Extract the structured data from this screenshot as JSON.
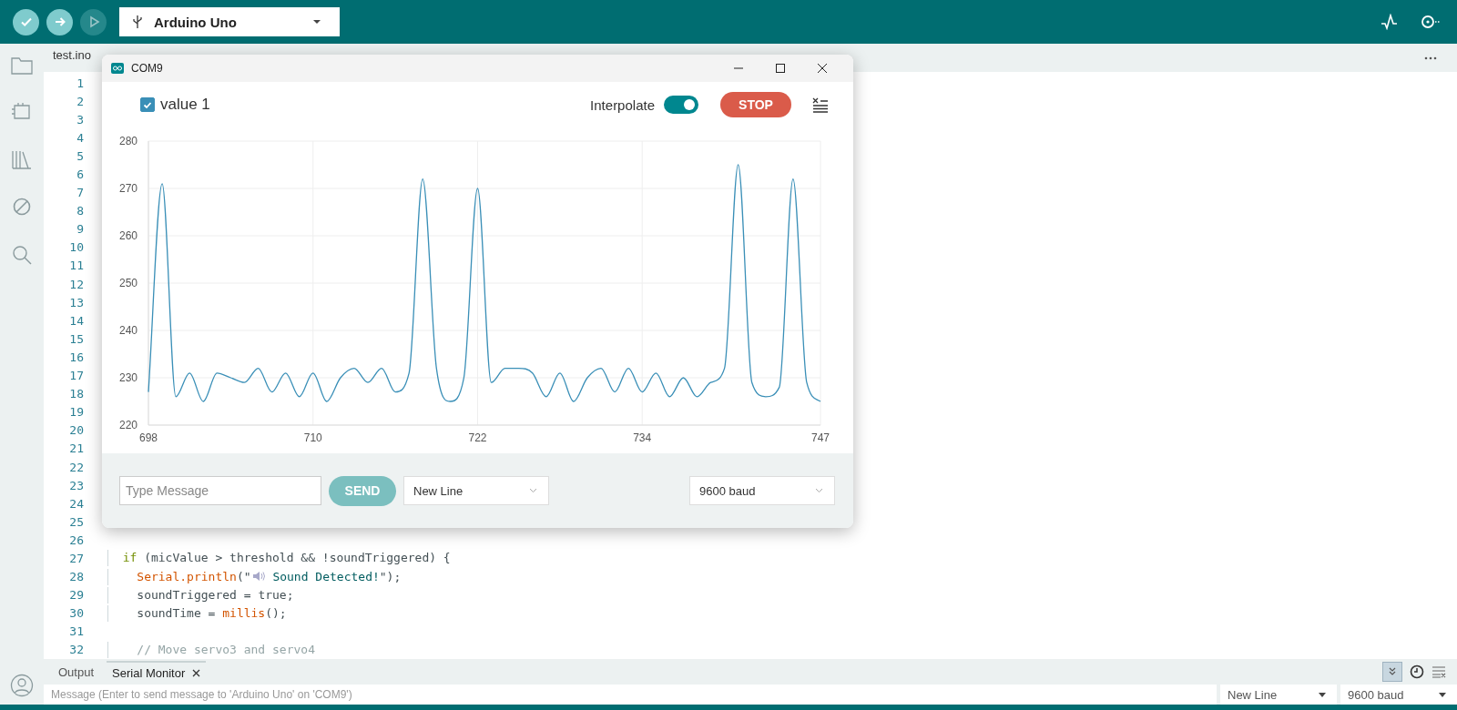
{
  "toolbar": {
    "debug_disabled": true,
    "board": "Arduino Uno"
  },
  "editor": {
    "tab": "test.ino",
    "lines": [
      {
        "number": "1"
      },
      {
        "number": "2"
      },
      {
        "number": "3"
      },
      {
        "number": "4"
      },
      {
        "number": "5"
      },
      {
        "number": "6"
      },
      {
        "number": "7"
      },
      {
        "number": "8"
      },
      {
        "number": "9"
      },
      {
        "number": "10"
      },
      {
        "number": "11"
      },
      {
        "number": "12"
      },
      {
        "number": "13"
      },
      {
        "number": "14"
      },
      {
        "number": "15"
      },
      {
        "number": "16"
      },
      {
        "number": "17"
      },
      {
        "number": "18"
      },
      {
        "number": "19"
      },
      {
        "number": "20"
      },
      {
        "number": "21"
      },
      {
        "number": "22"
      },
      {
        "number": "23"
      },
      {
        "number": "24"
      },
      {
        "number": "25"
      },
      {
        "number": "26"
      },
      {
        "number": "27",
        "tokens": [
          {
            "kind": "kw",
            "text": "  if"
          },
          {
            "kind": "plain",
            "text": " (micValue > threshold && !soundTriggered) {"
          }
        ]
      },
      {
        "number": "28",
        "tokens": [
          {
            "kind": "fn",
            "text": "    Serial"
          },
          {
            "kind": "fn",
            "text": ".println"
          },
          {
            "kind": "plain",
            "text": "(\""
          },
          {
            "kind": "icon"
          },
          {
            "kind": "str",
            "text": " Sound Detected!"
          },
          {
            "kind": "plain",
            "text": "\");"
          }
        ]
      },
      {
        "number": "29",
        "tokens": [
          {
            "kind": "plain",
            "text": "    soundTriggered = "
          },
          {
            "kind": "lit",
            "text": "true"
          },
          {
            "kind": "plain",
            "text": ";"
          }
        ]
      },
      {
        "number": "30",
        "tokens": [
          {
            "kind": "plain",
            "text": "    soundTime = "
          },
          {
            "kind": "fn",
            "text": "millis"
          },
          {
            "kind": "plain",
            "text": "();"
          }
        ]
      },
      {
        "number": "31"
      },
      {
        "number": "32",
        "tokens": [
          {
            "kind": "comment",
            "text": "    // Move servo3 and servo4"
          }
        ]
      }
    ]
  },
  "plotter": {
    "title": "COM9",
    "series": [
      {
        "checked": true
      }
    ],
    "interpolate_label": "Interpolate",
    "interpolate": true,
    "stop_label": "STOP",
    "chart_data": {
      "type": "line",
      "grid": true,
      "x": [
        698,
        699,
        700,
        701,
        702,
        703,
        704,
        705,
        706,
        707,
        708,
        709,
        710,
        711,
        712,
        713,
        714,
        715,
        716,
        717,
        718,
        719,
        720,
        721,
        722,
        723,
        724,
        725,
        726,
        727,
        728,
        729,
        730,
        731,
        732,
        733,
        734,
        735,
        736,
        737,
        738,
        739,
        740,
        741,
        742,
        743,
        744,
        745,
        746,
        747
      ],
      "series": [
        {
          "name": "value 1",
          "color": "#3a8fb7",
          "values": [
            227,
            271,
            226,
            231,
            225,
            231,
            230,
            229,
            232,
            227,
            231,
            226,
            231,
            225,
            230,
            232,
            229,
            232,
            227,
            231,
            272,
            232,
            225,
            230,
            270,
            229,
            232,
            232,
            231,
            226,
            231,
            225,
            230,
            232,
            227,
            232,
            227,
            231,
            226,
            230,
            226,
            229,
            232,
            275,
            229,
            226,
            228,
            272,
            229,
            225
          ]
        }
      ],
      "xlim": [
        698,
        747
      ],
      "ylim": [
        220,
        280
      ],
      "xticks": [
        698,
        710,
        722,
        734,
        747
      ],
      "yticks": [
        220,
        230,
        240,
        250,
        260,
        270,
        280
      ]
    },
    "message_placeholder": "Type Message",
    "send_label": "SEND",
    "line_ending": "New Line",
    "baud": "9600 baud"
  },
  "bottom_panel": {
    "tabs": [
      {
        "label": "Output",
        "selected": false,
        "closable": false
      },
      {
        "label": "Serial Monitor",
        "selected": true,
        "closable": true
      }
    ],
    "autoscroll": true,
    "message_placeholder": "Message (Enter to send message to 'Arduino Uno' on 'COM9')",
    "line_ending": "New Line",
    "baud": "9600 baud"
  }
}
